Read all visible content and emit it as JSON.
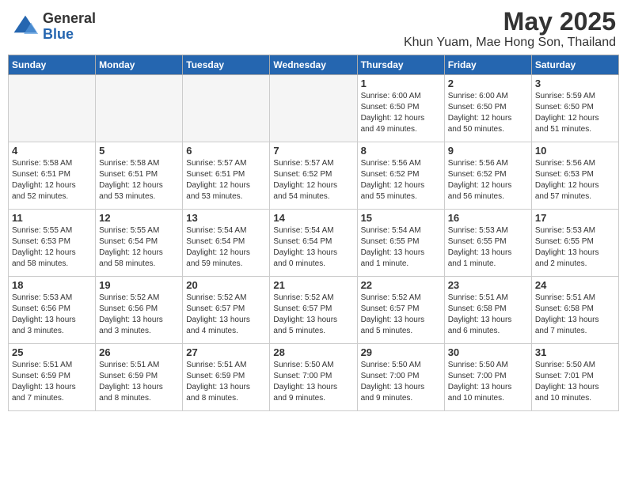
{
  "header": {
    "logo_general": "General",
    "logo_blue": "Blue",
    "month_title": "May 2025",
    "location": "Khun Yuam, Mae Hong Son, Thailand"
  },
  "weekdays": [
    "Sunday",
    "Monday",
    "Tuesday",
    "Wednesday",
    "Thursday",
    "Friday",
    "Saturday"
  ],
  "weeks": [
    [
      {
        "day": "",
        "info": ""
      },
      {
        "day": "",
        "info": ""
      },
      {
        "day": "",
        "info": ""
      },
      {
        "day": "",
        "info": ""
      },
      {
        "day": "1",
        "info": "Sunrise: 6:00 AM\nSunset: 6:50 PM\nDaylight: 12 hours\nand 49 minutes."
      },
      {
        "day": "2",
        "info": "Sunrise: 6:00 AM\nSunset: 6:50 PM\nDaylight: 12 hours\nand 50 minutes."
      },
      {
        "day": "3",
        "info": "Sunrise: 5:59 AM\nSunset: 6:50 PM\nDaylight: 12 hours\nand 51 minutes."
      }
    ],
    [
      {
        "day": "4",
        "info": "Sunrise: 5:58 AM\nSunset: 6:51 PM\nDaylight: 12 hours\nand 52 minutes."
      },
      {
        "day": "5",
        "info": "Sunrise: 5:58 AM\nSunset: 6:51 PM\nDaylight: 12 hours\nand 53 minutes."
      },
      {
        "day": "6",
        "info": "Sunrise: 5:57 AM\nSunset: 6:51 PM\nDaylight: 12 hours\nand 53 minutes."
      },
      {
        "day": "7",
        "info": "Sunrise: 5:57 AM\nSunset: 6:52 PM\nDaylight: 12 hours\nand 54 minutes."
      },
      {
        "day": "8",
        "info": "Sunrise: 5:56 AM\nSunset: 6:52 PM\nDaylight: 12 hours\nand 55 minutes."
      },
      {
        "day": "9",
        "info": "Sunrise: 5:56 AM\nSunset: 6:52 PM\nDaylight: 12 hours\nand 56 minutes."
      },
      {
        "day": "10",
        "info": "Sunrise: 5:56 AM\nSunset: 6:53 PM\nDaylight: 12 hours\nand 57 minutes."
      }
    ],
    [
      {
        "day": "11",
        "info": "Sunrise: 5:55 AM\nSunset: 6:53 PM\nDaylight: 12 hours\nand 58 minutes."
      },
      {
        "day": "12",
        "info": "Sunrise: 5:55 AM\nSunset: 6:54 PM\nDaylight: 12 hours\nand 58 minutes."
      },
      {
        "day": "13",
        "info": "Sunrise: 5:54 AM\nSunset: 6:54 PM\nDaylight: 12 hours\nand 59 minutes."
      },
      {
        "day": "14",
        "info": "Sunrise: 5:54 AM\nSunset: 6:54 PM\nDaylight: 13 hours\nand 0 minutes."
      },
      {
        "day": "15",
        "info": "Sunrise: 5:54 AM\nSunset: 6:55 PM\nDaylight: 13 hours\nand 1 minute."
      },
      {
        "day": "16",
        "info": "Sunrise: 5:53 AM\nSunset: 6:55 PM\nDaylight: 13 hours\nand 1 minute."
      },
      {
        "day": "17",
        "info": "Sunrise: 5:53 AM\nSunset: 6:55 PM\nDaylight: 13 hours\nand 2 minutes."
      }
    ],
    [
      {
        "day": "18",
        "info": "Sunrise: 5:53 AM\nSunset: 6:56 PM\nDaylight: 13 hours\nand 3 minutes."
      },
      {
        "day": "19",
        "info": "Sunrise: 5:52 AM\nSunset: 6:56 PM\nDaylight: 13 hours\nand 3 minutes."
      },
      {
        "day": "20",
        "info": "Sunrise: 5:52 AM\nSunset: 6:57 PM\nDaylight: 13 hours\nand 4 minutes."
      },
      {
        "day": "21",
        "info": "Sunrise: 5:52 AM\nSunset: 6:57 PM\nDaylight: 13 hours\nand 5 minutes."
      },
      {
        "day": "22",
        "info": "Sunrise: 5:52 AM\nSunset: 6:57 PM\nDaylight: 13 hours\nand 5 minutes."
      },
      {
        "day": "23",
        "info": "Sunrise: 5:51 AM\nSunset: 6:58 PM\nDaylight: 13 hours\nand 6 minutes."
      },
      {
        "day": "24",
        "info": "Sunrise: 5:51 AM\nSunset: 6:58 PM\nDaylight: 13 hours\nand 7 minutes."
      }
    ],
    [
      {
        "day": "25",
        "info": "Sunrise: 5:51 AM\nSunset: 6:59 PM\nDaylight: 13 hours\nand 7 minutes."
      },
      {
        "day": "26",
        "info": "Sunrise: 5:51 AM\nSunset: 6:59 PM\nDaylight: 13 hours\nand 8 minutes."
      },
      {
        "day": "27",
        "info": "Sunrise: 5:51 AM\nSunset: 6:59 PM\nDaylight: 13 hours\nand 8 minutes."
      },
      {
        "day": "28",
        "info": "Sunrise: 5:50 AM\nSunset: 7:00 PM\nDaylight: 13 hours\nand 9 minutes."
      },
      {
        "day": "29",
        "info": "Sunrise: 5:50 AM\nSunset: 7:00 PM\nDaylight: 13 hours\nand 9 minutes."
      },
      {
        "day": "30",
        "info": "Sunrise: 5:50 AM\nSunset: 7:00 PM\nDaylight: 13 hours\nand 10 minutes."
      },
      {
        "day": "31",
        "info": "Sunrise: 5:50 AM\nSunset: 7:01 PM\nDaylight: 13 hours\nand 10 minutes."
      }
    ]
  ]
}
